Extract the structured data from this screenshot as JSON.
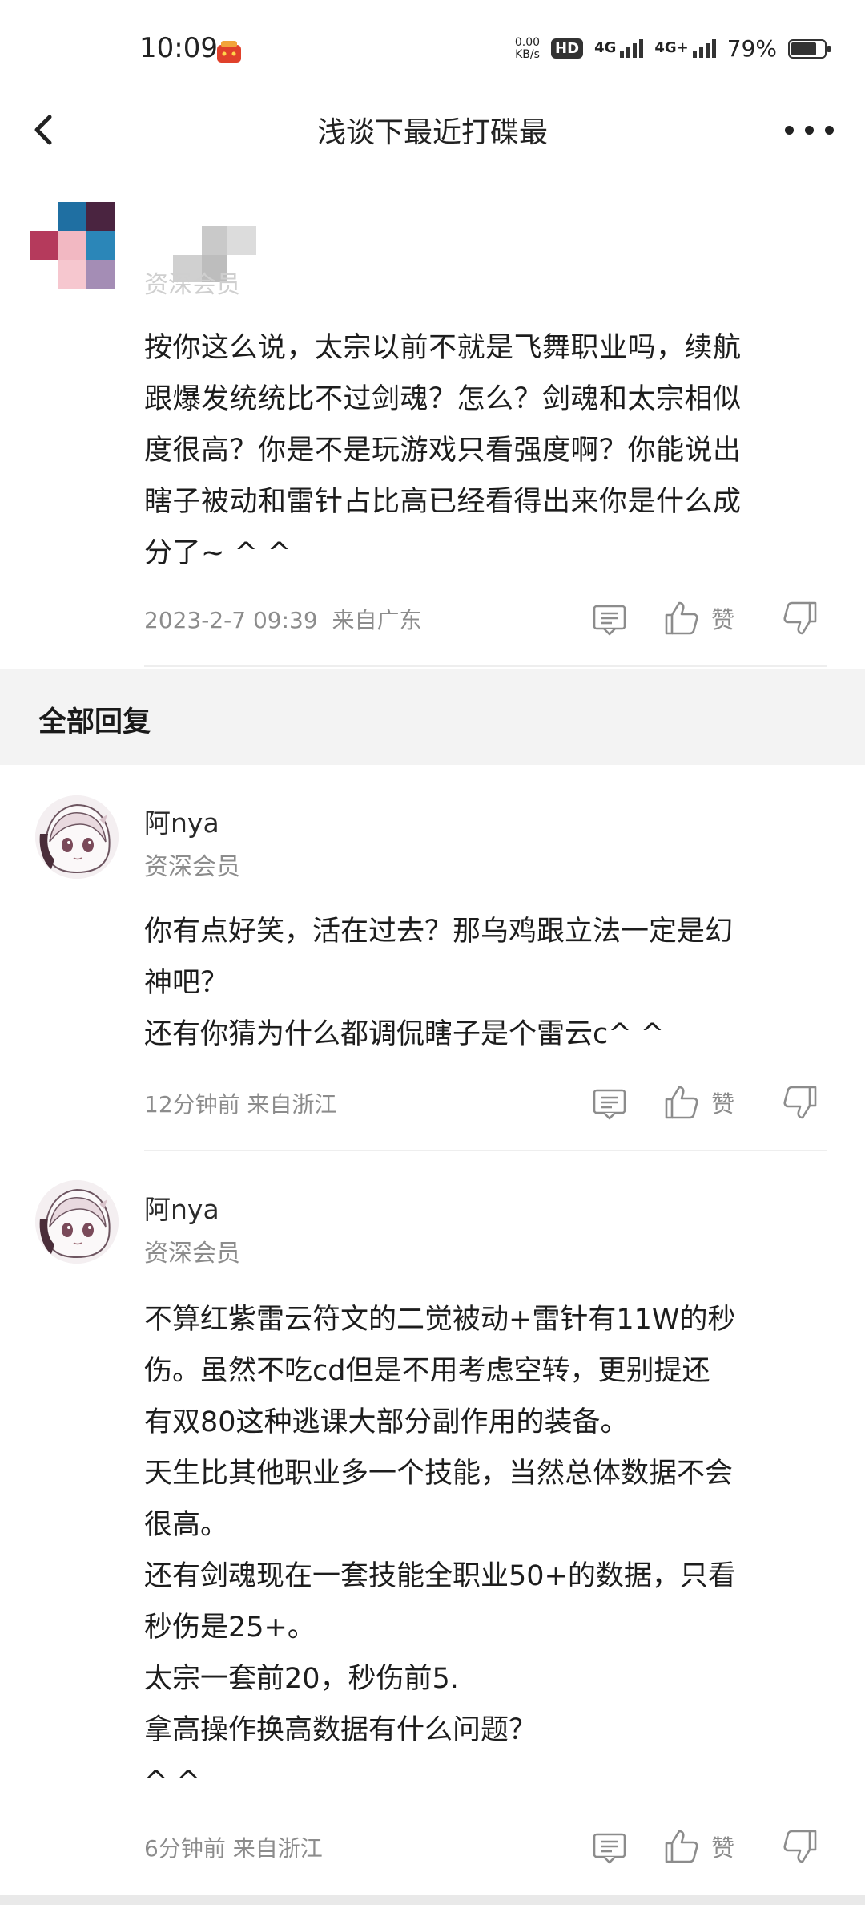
{
  "status_bar": {
    "time": "10:09",
    "net_speed_value": "0.00",
    "net_speed_unit": "KB/s",
    "hd": "HD",
    "signal1": "4G",
    "signal2": "4G+",
    "battery": "79%"
  },
  "nav": {
    "title": "浅谈下最近打碟最",
    "back_icon": "chevron-left-icon",
    "more_icon": "more-dots-icon"
  },
  "post": {
    "member_label": "资深会员",
    "text": "按你这么说，太宗以前不就是飞舞职业吗，续航\n跟爆发统统比不过剑魂？怎么？剑魂和太宗相似\n度很高？你是不是玩游戏只看强度啊？你能说出\n瞎子被动和雷针占比高已经看得出来你是什么成\n分了~ ^ ^",
    "time": "2023-2-7 09:39",
    "location": "来自广东",
    "like_label": "赞"
  },
  "section_title": "全部回复",
  "replies": [
    {
      "name": "阿nya",
      "member": "资深会员",
      "text": "你有点好笑，活在过去？那乌鸡跟立法一定是幻\n神吧？\n还有你猜为什么都调侃瞎子是个雷云c^ ^",
      "time": "12分钟前",
      "location": "来自浙江",
      "like_label": "赞"
    },
    {
      "name": "阿nya",
      "member": "资深会员",
      "text": "不算红紫雷云符文的二觉被动+雷针有11W的秒\n伤。虽然不吃cd但是不用考虑空转，更别提还\n有双80这种逃课大部分副作用的装备。\n天生比其他职业多一个技能，当然总体数据不会\n很高。\n还有剑魂现在一套技能全职业50+的数据，只看\n秒伤是25+。\n太宗一套前20，秒伤前5.\n拿高操作换高数据有什么问题？\n^ ^",
      "time": "6分钟前",
      "location": "来自浙江",
      "like_label": "赞"
    }
  ],
  "colors": {
    "text": "#1d1d1d",
    "muted": "#8c8c8c",
    "band": "#f3f3f3"
  }
}
